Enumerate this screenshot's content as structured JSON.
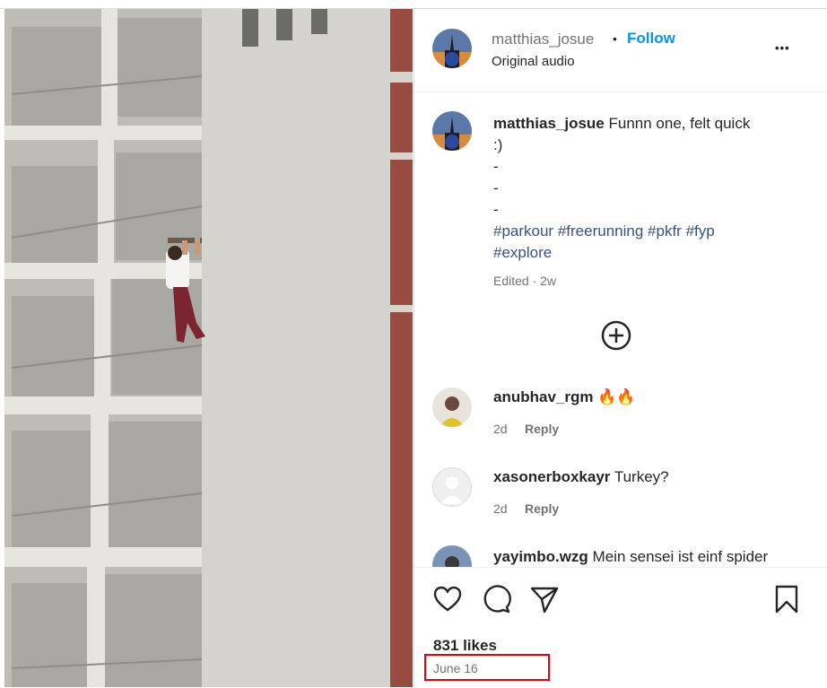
{
  "post": {
    "username": "matthias_josue",
    "separator": "•",
    "follow_label": "Follow",
    "audio": "Original audio",
    "more_label": "•••"
  },
  "caption": {
    "username": "matthias_josue",
    "text_line1": "Funnn one, felt quick",
    "text_line2": ":)",
    "dash1": "-",
    "dash2": "-",
    "dash3": "-",
    "tags": [
      "#parkour",
      "#freerunning",
      "#pkfr",
      "#fyp",
      "#explore"
    ],
    "meta": "Edited · 2w"
  },
  "comments": [
    {
      "username": "anubhav_rgm",
      "text": "🔥🔥",
      "time": "2d",
      "reply": "Reply"
    },
    {
      "username": "xasonerboxkayr",
      "text": "Turkey?",
      "time": "2d",
      "reply": "Reply"
    },
    {
      "username": "yayimbo.wzg",
      "text": "Mein sensei ist einf spider"
    }
  ],
  "stats": {
    "likes": "831 likes",
    "date": "June 16"
  },
  "colors": {
    "accent": "#0095f6",
    "hashtag": "#385185",
    "highlight": "#e0000e"
  }
}
